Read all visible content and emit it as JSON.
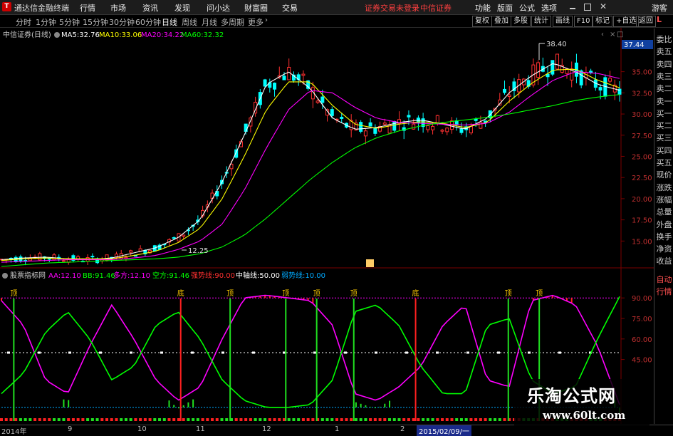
{
  "app": {
    "title": "通达信金融终端",
    "menus": [
      "行情",
      "市场",
      "资讯",
      "发现",
      "问小达",
      "财富圈",
      "交易"
    ],
    "status_login": "证券交易未登录",
    "status_broker": "中信证券",
    "right_menus": [
      "功能",
      "版面",
      "公式",
      "选项"
    ],
    "guest": "游客"
  },
  "toolbar": {
    "periods": [
      "分时",
      "1分钟",
      "5分钟",
      "15分钟",
      "30分钟",
      "60分钟",
      "日线",
      "周线",
      "月线",
      "多周期",
      "更多"
    ],
    "active_period": "日线",
    "right_tools": [
      "复权",
      "叠加",
      "多股",
      "统计",
      "画线",
      "F10",
      "标记",
      "+自选",
      "返回"
    ]
  },
  "main_panel": {
    "stock_label": "中信证券(日线)",
    "ma": [
      {
        "label": "MA5:",
        "value": "32.76",
        "color": "#ffffff"
      },
      {
        "label": "MA10:",
        "value": "33.06",
        "color": "#ffff00"
      },
      {
        "label": "MA20:",
        "value": "34.22",
        "color": "#ff00ff"
      },
      {
        "label": "MA60:",
        "value": "32.32",
        "color": "#00ff00"
      }
    ],
    "price_ticks": [
      "35.00",
      "32.50",
      "30.00",
      "27.50",
      "25.00",
      "22.50",
      "20.00",
      "17.50",
      "15.00"
    ],
    "current_price": "37.44",
    "high_label": "38.40",
    "low_label": "12.25"
  },
  "indicator_panel": {
    "name": "股票指标网",
    "items": [
      {
        "label": "AA:",
        "value": "12.10",
        "color": "#ff00ff"
      },
      {
        "label": "BB:",
        "value": "91.46",
        "color": "#00ff00"
      },
      {
        "label": "多方:",
        "value": "12.10",
        "color": "#ff00ff"
      },
      {
        "label": "空方:",
        "value": "91.46",
        "color": "#00ff00"
      },
      {
        "label": "强势线:",
        "value": "90.00",
        "color": "#ff3030"
      },
      {
        "label": "中轴线:",
        "value": "50.00",
        "color": "#ffffff"
      },
      {
        "label": "弱势线:",
        "value": "10.00",
        "color": "#00aaff"
      }
    ],
    "ticks": [
      "90.00",
      "75.00",
      "60.00",
      "45.00"
    ],
    "signal_top": "顶",
    "signal_bottom": "底"
  },
  "right_panel": {
    "items": [
      "委比",
      "卖五",
      "卖四",
      "卖三",
      "卖二",
      "卖一",
      "买一",
      "买二",
      "买三",
      "买四",
      "买五",
      "现价",
      "涨跌",
      "涨幅",
      "总量",
      "外盘",
      "换手",
      "净资",
      "收益"
    ],
    "bottom_items": [
      "自动",
      "行情"
    ],
    "corner": "L"
  },
  "date_axis": {
    "labels": [
      "2014年",
      "9",
      "10",
      "11",
      "12",
      "1",
      "2"
    ],
    "cursor_date": "2015/02/09/一"
  },
  "watermark": {
    "line1": "乐淘公式网",
    "line2": "www.60lt.com"
  },
  "chart_data": {
    "type": "candlestick",
    "title": "中信证券(日线)",
    "series": [
      {
        "name": "MA5",
        "values": [
          12.8,
          13.0,
          13.1,
          12.9,
          12.8,
          13.0,
          13.6,
          14.2,
          15.4,
          17.5,
          22.0,
          27.5,
          33.5,
          35.0,
          33.0,
          29.5,
          28.2,
          28.4,
          29.0,
          29.3,
          28.8,
          28.2,
          29.5,
          32.5,
          34.5,
          36.0,
          35.0,
          33.5,
          32.8
        ]
      },
      {
        "name": "MA10",
        "values": [
          12.7,
          12.9,
          13.0,
          12.9,
          12.9,
          12.9,
          13.3,
          13.8,
          14.8,
          16.5,
          20.0,
          25.0,
          30.5,
          33.8,
          33.8,
          31.0,
          28.8,
          28.3,
          28.8,
          29.1,
          28.9,
          28.4,
          29.0,
          31.5,
          33.6,
          35.2,
          35.3,
          34.0,
          33.1
        ]
      },
      {
        "name": "MA20",
        "values": [
          12.5,
          12.6,
          12.7,
          12.8,
          12.8,
          12.8,
          13.0,
          13.3,
          14.0,
          15.0,
          17.0,
          21.0,
          26.0,
          30.5,
          32.8,
          32.5,
          30.8,
          29.5,
          29.0,
          28.9,
          28.8,
          28.7,
          28.9,
          30.2,
          32.2,
          34.0,
          35.0,
          34.8,
          34.2
        ]
      },
      {
        "name": "MA60",
        "values": [
          12.0,
          12.2,
          12.4,
          12.5,
          12.6,
          12.7,
          12.8,
          12.9,
          13.1,
          13.5,
          14.3,
          15.7,
          17.7,
          20.0,
          22.3,
          24.3,
          26.0,
          27.2,
          28.0,
          28.6,
          29.0,
          29.3,
          29.6,
          30.0,
          30.5,
          31.0,
          31.6,
          32.0,
          32.3
        ]
      }
    ],
    "ylim": [
      12,
      38.5
    ],
    "price_ticks": [
      15,
      17.5,
      20,
      22.5,
      25,
      27.5,
      30,
      32.5,
      35
    ],
    "indicator": {
      "name": "股票指标网",
      "lines": {
        "强势线": 90,
        "中轴线": 50,
        "弱势线": 10
      },
      "series": [
        {
          "name": "AA",
          "values": [
            88,
            70,
            30,
            20,
            55,
            85,
            60,
            30,
            15,
            25,
            60,
            90,
            92,
            90,
            88,
            70,
            20,
            15,
            25,
            40,
            70,
            85,
            30,
            25,
            88,
            92,
            85,
            55,
            12
          ]
        },
        {
          "name": "BB",
          "values": [
            20,
            35,
            65,
            80,
            60,
            30,
            40,
            70,
            80,
            60,
            30,
            15,
            10,
            10,
            12,
            30,
            80,
            85,
            70,
            40,
            20,
            20,
            70,
            75,
            30,
            20,
            25,
            60,
            91
          ]
        }
      ]
    }
  }
}
